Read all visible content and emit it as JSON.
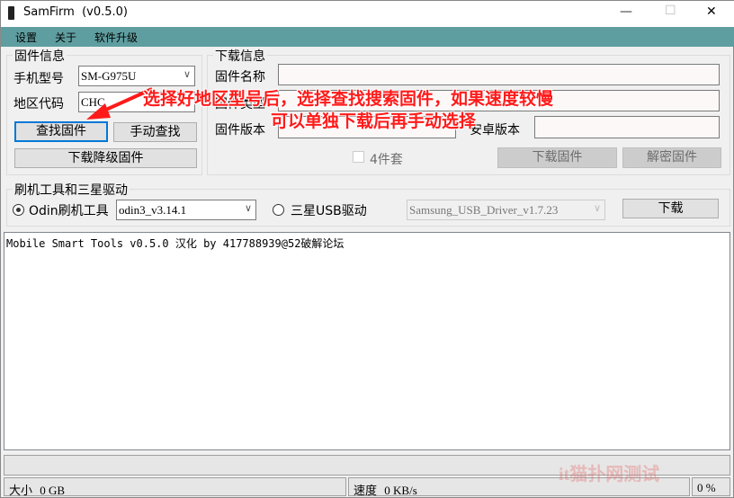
{
  "window": {
    "title": "SamFirm  (v0.5.0)",
    "minimize": "—",
    "maximize": "☐",
    "close": "✕"
  },
  "menu": [
    "设置",
    "关于",
    "软件升级"
  ],
  "firmware_info": {
    "title": "固件信息",
    "model_label": "手机型号",
    "model_value": "SM-G975U",
    "region_label": "地区代码",
    "region_value": "CHC",
    "find_button": "查找固件",
    "manual_button": "手动查找",
    "downgrade_button": "下载降级固件"
  },
  "download_info": {
    "title": "下载信息",
    "name_label": "固件名称",
    "type_label": "固件类型",
    "version_label": "固件版本",
    "android_label": "安卓版本",
    "four_pack_label": "4件套",
    "download_button": "下载固件",
    "decrypt_button": "解密固件"
  },
  "tools": {
    "title": "刷机工具和三星驱动",
    "odin_label": "Odin刷机工具",
    "odin_value": "odin3_v3.14.1",
    "usb_label": "三星USB驱动",
    "usb_value": "Samsung_USB_Driver_v1.7.23",
    "download_button": "下载"
  },
  "log": {
    "text": "Mobile Smart Tools v0.5.0 汉化 by 417788939@52破解论坛"
  },
  "status": {
    "size_label": "大小",
    "size_value": "0 GB",
    "speed_label": "速度",
    "speed_value": "0 KB/s",
    "percent": "0 %",
    "progress": 0
  },
  "annotation": {
    "line1": "选择好地区型号后，选择查找搜索固件，如果速度较慢",
    "line2": "可以单独下载后再手动选择"
  },
  "watermark": "it猫扑网测试",
  "colors": {
    "menubar": "#5f9ea0",
    "annotation": "#ff1a1a",
    "focus": "#0078d7"
  }
}
